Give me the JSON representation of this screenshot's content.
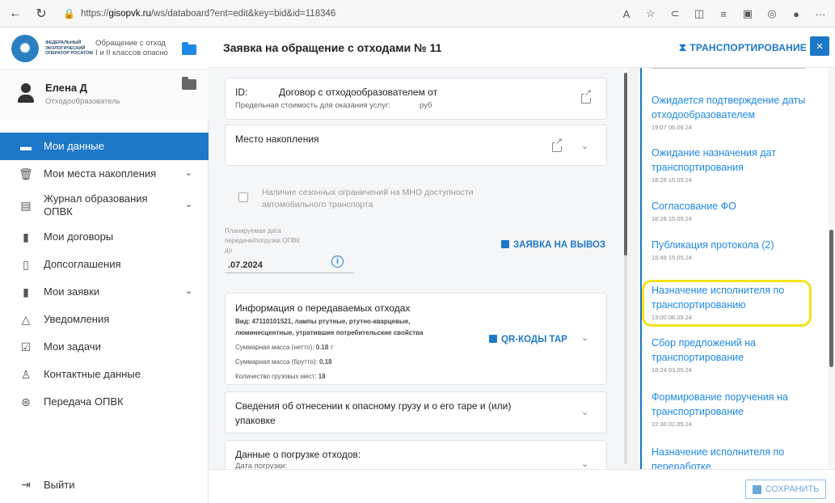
{
  "browser": {
    "url_prefix": "https://",
    "url_host": "gisopvk.ru",
    "url_path": "/ws/databoard?ent=edit&key=bid&id=118346",
    "icons": [
      "back-icon",
      "reload-icon",
      "lock-icon",
      "read-aloud-icon",
      "favorite-icon",
      "extensions-icon",
      "split-icon",
      "favorites-icon",
      "collections-icon",
      "copilot-icon",
      "profile-icon",
      "more-icon"
    ]
  },
  "sidebar": {
    "logo_text": "ФЕДЕРАЛЬНЫЙ ЭКОЛОГИЧЕСКИЙ ОПЕРАТОР РОСАТОМ",
    "logo_sub_1": "Обращение с отход",
    "logo_sub_2": "I и II классов опасно",
    "user_name": "Елена Д",
    "user_role": "Отходообразователь",
    "items": [
      {
        "label": "Мои данные",
        "icon": "folder-icon",
        "active": true
      },
      {
        "label": "Мои места накопления",
        "icon": "bin-icon",
        "chevron": true
      },
      {
        "label": "Журнал образования ОПВК",
        "icon": "journal-icon",
        "chevron": true
      },
      {
        "label": "Мои договоры",
        "icon": "document-icon"
      },
      {
        "label": "Допсоглашения",
        "icon": "addendum-icon"
      },
      {
        "label": "Мои заявки",
        "icon": "requests-icon",
        "chevron": true
      },
      {
        "label": "Уведомления",
        "icon": "bell-icon"
      },
      {
        "label": "Мои задачи",
        "icon": "tasks-icon"
      },
      {
        "label": "Контактные данные",
        "icon": "contacts-icon"
      },
      {
        "label": "Передача ОПВК",
        "icon": "transfer-icon"
      }
    ],
    "logout_label": "Выйти"
  },
  "header": {
    "title": "Заявка на обращение с отходами № 11",
    "transport_label": "ТРАНСПОРТИРОВАНИЕ",
    "close_label": "×"
  },
  "contract": {
    "id_label": "ID:",
    "title": "Договор с отходообразователем от",
    "limit_label": "Предельная стоимость для оказания услуг:",
    "limit_unit": "руб"
  },
  "accumulation": {
    "title": "Место накопления"
  },
  "seasonal": {
    "label": "Наличие сезонных ограничений на МНО доступности автомобильного транспорта"
  },
  "planned": {
    "label_1": "Планируемая дата",
    "label_2": "передачи/погрузки ОПВК",
    "label_3": "до",
    "date_value": ".07.2024",
    "export_request": "ЗАЯВКА НА ВЫВОЗ"
  },
  "waste": {
    "title": "Информация о передаваемых отходах",
    "type_line_1": "Вид: 47110101521, лампы ртутные, ртутно-кварцевые,",
    "type_line_2": "люминесцентные, утратившие потребительские свойства",
    "net_label": "Суммарная масса (нетто):",
    "net_value": "0.18",
    "net_unit": "т",
    "gross_label": "Суммарная масса (брутто):",
    "gross_value": "0.18",
    "places_label": "Количество грузовых мест:",
    "places_value": "18",
    "qr_label": "QR-КОДЫ ТАР"
  },
  "hazard": {
    "title_1": "Сведения об отнесении к опасному грузу и о его таре и (или)",
    "title_2": "упаковке"
  },
  "loading": {
    "title": "Данные о погрузке отходов:",
    "date_label": "Дата погрузки:"
  },
  "history": [
    {
      "title": "Ожидается подтверждение даты отходообразователем",
      "time": "19:07 06.06.24"
    },
    {
      "title": "Ожидание назначения дат транспортирования",
      "time": "18:26 15.05.24"
    },
    {
      "title": "Согласование ФО",
      "time": "18:26 15.05.24"
    },
    {
      "title": "Публикация протокола (2)",
      "time": "15:49 15.05.24"
    },
    {
      "title": "Назначение исполнителя по транспортированию",
      "time": "13:00 08.05.24"
    },
    {
      "title": "Сбор предложений на транспортирование",
      "time": "18:24 03.05.24"
    },
    {
      "title": "Формирование поручения на транспортирование",
      "time": "22:30 02.05.24"
    },
    {
      "title": "Назначение исполнителя по переработке",
      "time": ""
    }
  ],
  "footer": {
    "save_label": "СОХРАНИТЬ"
  }
}
